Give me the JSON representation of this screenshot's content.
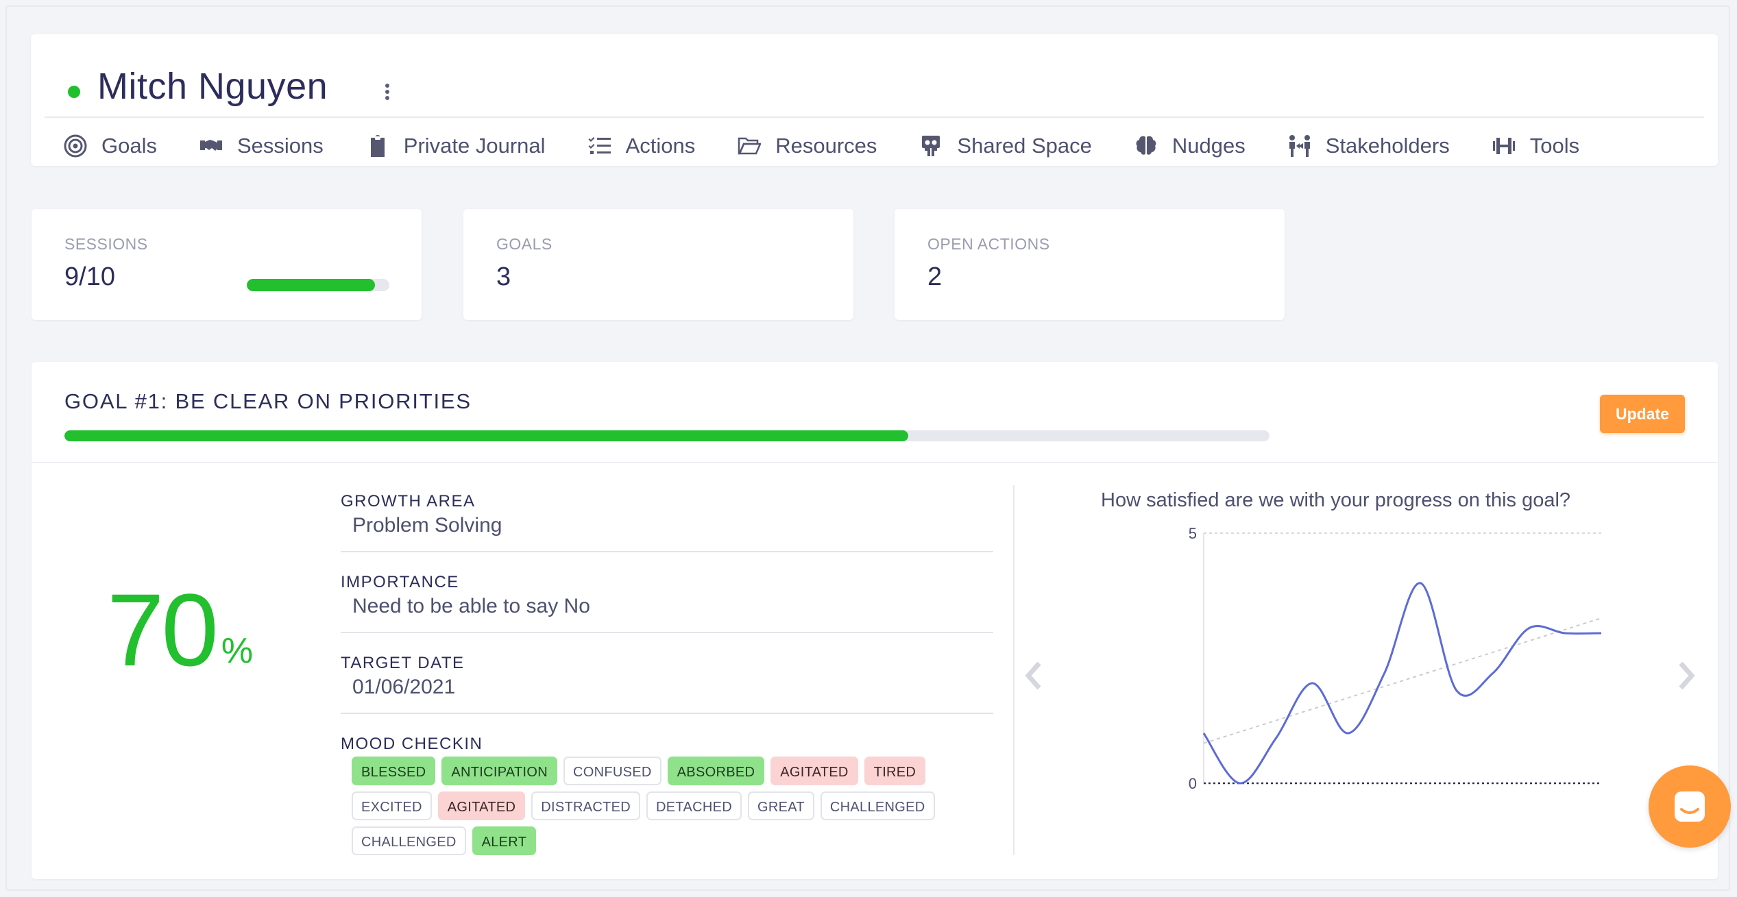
{
  "user": {
    "name": "Mitch Nguyen",
    "status_color": "#22bf2f"
  },
  "nav": [
    {
      "label": "Goals",
      "icon": "target-icon"
    },
    {
      "label": "Sessions",
      "icon": "handshake-icon"
    },
    {
      "label": "Private Journal",
      "icon": "clipboard-icon"
    },
    {
      "label": "Actions",
      "icon": "checklist-icon"
    },
    {
      "label": "Resources",
      "icon": "folder-open-icon"
    },
    {
      "label": "Shared Space",
      "icon": "slideshare-icon"
    },
    {
      "label": "Nudges",
      "icon": "brain-icon"
    },
    {
      "label": "Stakeholders",
      "icon": "people-arrows-icon"
    },
    {
      "label": "Tools",
      "icon": "dumbbell-icon"
    }
  ],
  "stats": {
    "sessions": {
      "label": "SESSIONS",
      "value": "9/10",
      "progress": 0.9
    },
    "goals": {
      "label": "GOALS",
      "value": "3"
    },
    "open_actions": {
      "label": "OPEN ACTIONS",
      "value": "2"
    }
  },
  "goal": {
    "title": "GOAL #1: BE CLEAR ON PRIORITIES",
    "progress": 0.7,
    "update_label": "Update",
    "percent": "70",
    "percent_sign": "%",
    "growth_area": {
      "label": "GROWTH AREA",
      "value": "Problem Solving"
    },
    "importance": {
      "label": "IMPORTANCE",
      "value": "Need to be able to say No"
    },
    "target_date": {
      "label": "TARGET DATE",
      "value": "01/06/2021"
    },
    "mood_checkin": {
      "label": "MOOD CHECKIN",
      "tags": [
        {
          "text": "BLESSED",
          "tone": "pos"
        },
        {
          "text": "ANTICIPATION",
          "tone": "pos"
        },
        {
          "text": "CONFUSED",
          "tone": "neutral"
        },
        {
          "text": "ABSORBED",
          "tone": "pos"
        },
        {
          "text": "AGITATED",
          "tone": "neg"
        },
        {
          "text": "TIRED",
          "tone": "neg"
        },
        {
          "text": "EXCITED",
          "tone": "neutral"
        },
        {
          "text": "AGITATED",
          "tone": "neg"
        },
        {
          "text": "DISTRACTED",
          "tone": "neutral"
        },
        {
          "text": "DETACHED",
          "tone": "neutral"
        },
        {
          "text": "GREAT",
          "tone": "neutral"
        },
        {
          "text": "CHALLENGED",
          "tone": "neutral"
        },
        {
          "text": "CHALLENGED",
          "tone": "neutral"
        },
        {
          "text": "ALERT",
          "tone": "pos"
        }
      ]
    }
  },
  "colors": {
    "accent_green": "#22bf2f",
    "accent_orange": "#ff9a3d",
    "chart_line": "#5c6bd6"
  },
  "chart_data": {
    "type": "line",
    "title": "How satisfied are we with your progress on this goal?",
    "ylim": [
      0,
      5
    ],
    "yticks": [
      "0",
      "5"
    ],
    "series": [
      {
        "values": [
          1.0,
          0.0,
          0.9,
          2.0,
          1.0,
          2.2,
          4.0,
          1.85,
          2.2,
          3.1,
          3.0,
          3.0
        ]
      }
    ],
    "trendline": {
      "start": 0.8,
      "end": 3.3
    },
    "grid": true
  }
}
